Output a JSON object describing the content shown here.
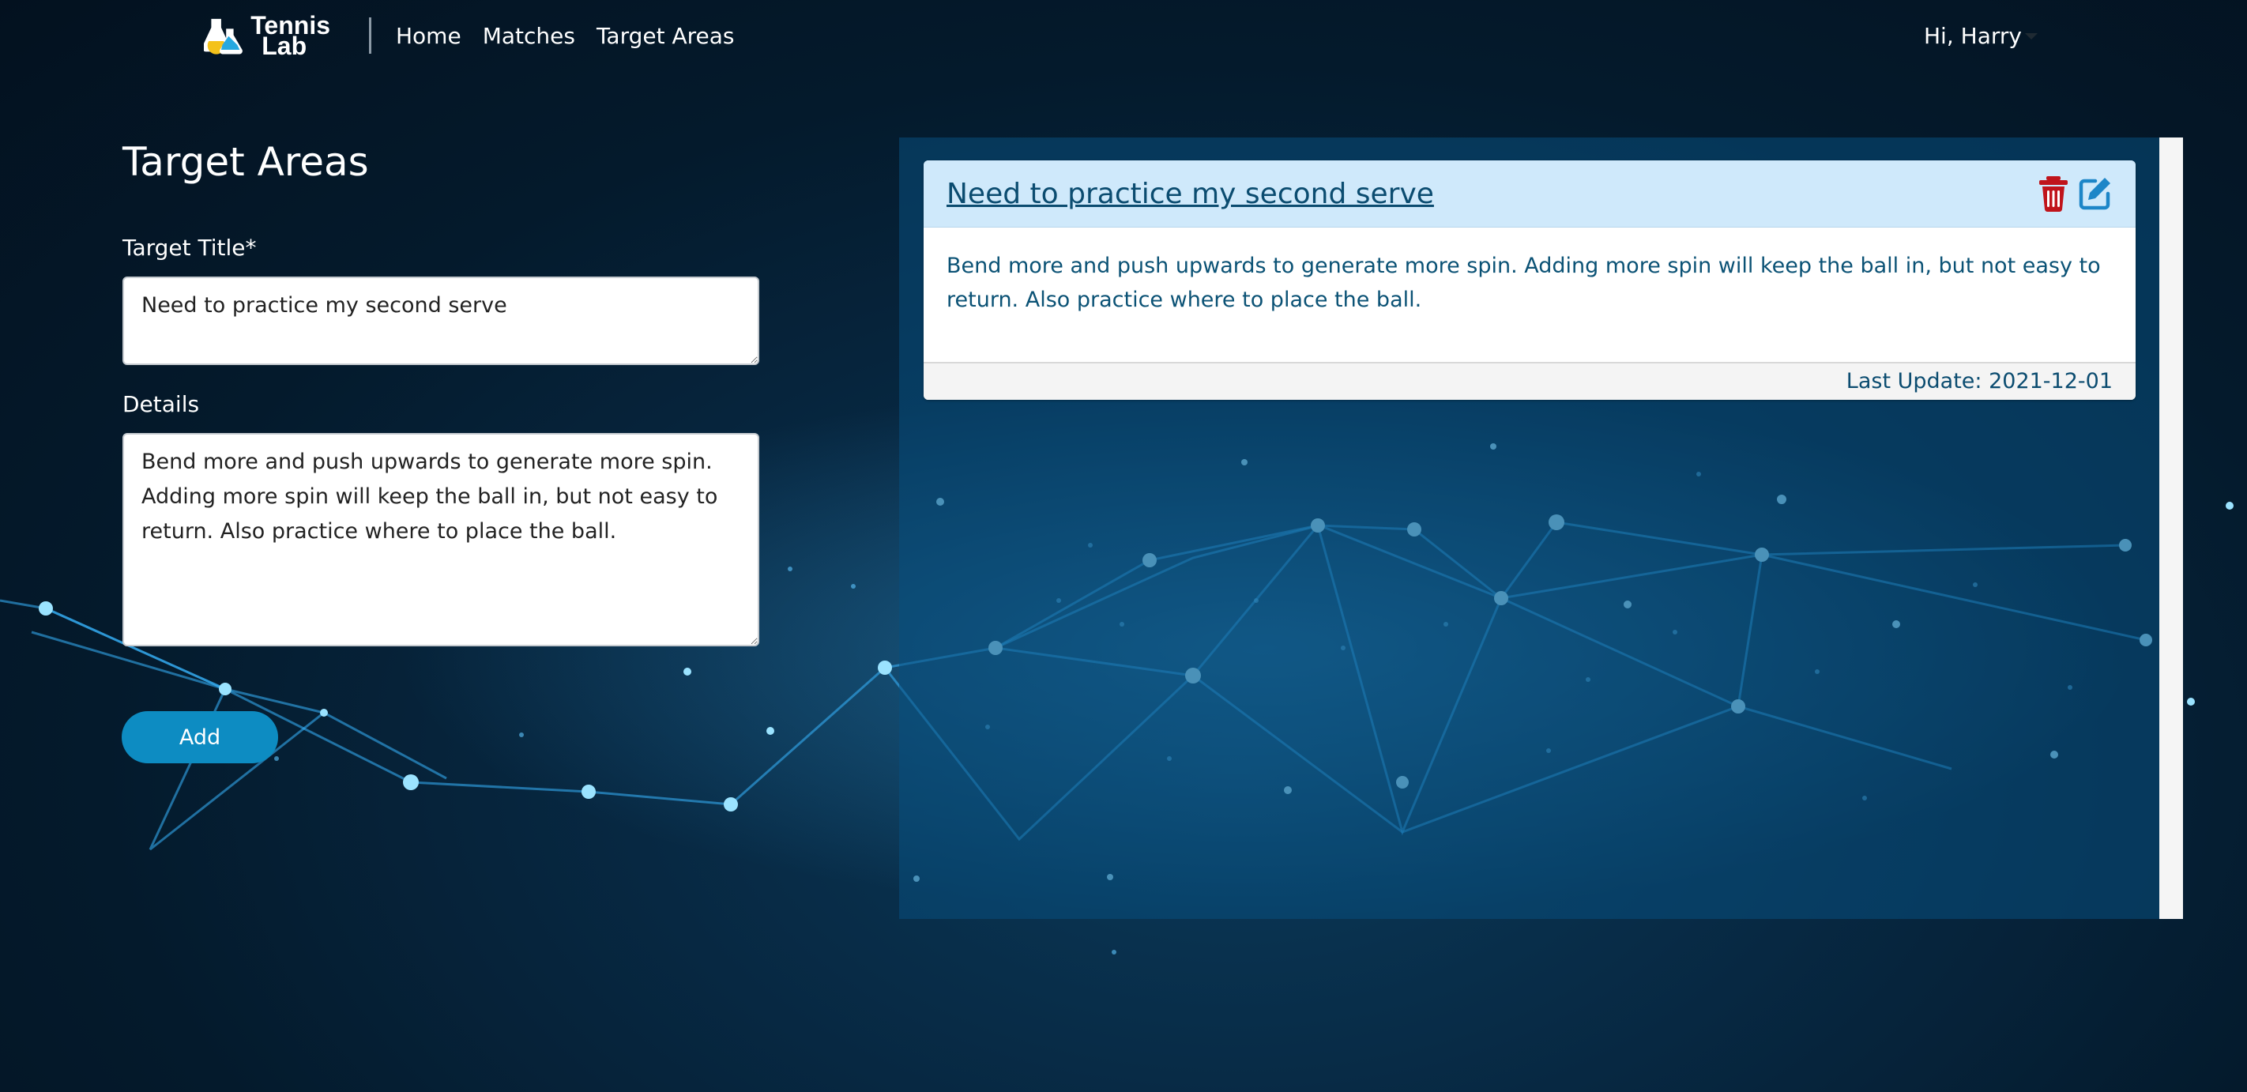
{
  "app": {
    "logo_text_line1": "Tennis",
    "logo_text_line2": "Lab"
  },
  "nav": {
    "items": [
      "Home",
      "Matches",
      "Target Areas"
    ],
    "greeting": "Hi, Harry"
  },
  "form": {
    "page_title": "Target Areas",
    "title_label": "Target Title*",
    "title_value": "Need to practice my second serve",
    "details_label": "Details",
    "details_value": "Bend more and push upwards to generate more spin. Adding more spin will keep the ball in, but not easy to return. Also practice where to place the ball.",
    "add_label": "Add"
  },
  "targets": [
    {
      "title": "Need to practice my second serve",
      "details": "Bend more and push upwards to generate more spin. Adding more spin will keep the ball in, but not easy to return. Also practice where to place the ball.",
      "last_update": "Last Update: 2021-12-01"
    }
  ],
  "colors": {
    "accent": "#0d8cc2",
    "delete": "#c0141b",
    "edit": "#1d86c8",
    "card_header": "#cfe9fb",
    "card_text": "#0b5275"
  },
  "icons": {
    "delete": "trash-icon",
    "edit": "edit-icon",
    "logo": "flask-icon"
  }
}
